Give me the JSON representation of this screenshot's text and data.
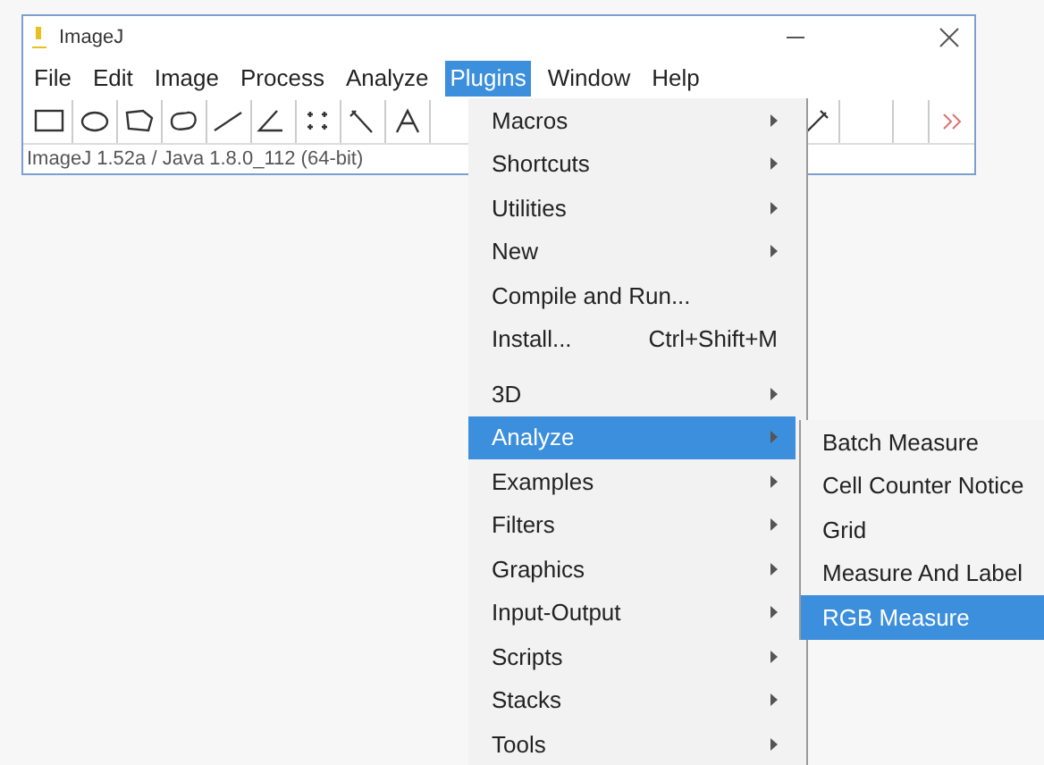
{
  "window": {
    "title": "ImageJ"
  },
  "menu_bar": [
    {
      "label": "File",
      "selected": false
    },
    {
      "label": "Edit",
      "selected": false
    },
    {
      "label": "Image",
      "selected": false
    },
    {
      "label": "Process",
      "selected": false
    },
    {
      "label": "Analyze",
      "selected": false
    },
    {
      "label": "Plugins",
      "selected": true
    },
    {
      "label": "Window",
      "selected": false
    },
    {
      "label": "Help",
      "selected": false
    }
  ],
  "status_bar": "ImageJ 1.52a / Java 1.8.0_112 (64-bit)",
  "plugins_menu": [
    {
      "label": "Macros",
      "submenu": true,
      "selected": false
    },
    {
      "label": "Shortcuts",
      "submenu": true,
      "selected": false
    },
    {
      "label": "Utilities",
      "submenu": true,
      "selected": false
    },
    {
      "label": "New",
      "submenu": true,
      "selected": false
    },
    {
      "label": "Compile and Run...",
      "submenu": false,
      "selected": false
    },
    {
      "label": "Install...",
      "shortcut": "Ctrl+Shift+M",
      "submenu": false,
      "selected": false
    },
    {
      "label": "3D",
      "submenu": true,
      "selected": false,
      "separator_before": true
    },
    {
      "label": "Analyze",
      "submenu": true,
      "selected": true
    },
    {
      "label": "Examples",
      "submenu": true,
      "selected": false
    },
    {
      "label": "Filters",
      "submenu": true,
      "selected": false
    },
    {
      "label": "Graphics",
      "submenu": true,
      "selected": false
    },
    {
      "label": "Input-Output",
      "submenu": true,
      "selected": false
    },
    {
      "label": "Scripts",
      "submenu": true,
      "selected": false
    },
    {
      "label": "Stacks",
      "submenu": true,
      "selected": false
    },
    {
      "label": "Tools",
      "submenu": true,
      "selected": false
    }
  ],
  "analyze_submenu": [
    {
      "label": "Batch Measure",
      "selected": false
    },
    {
      "label": "Cell Counter Notice",
      "selected": false
    },
    {
      "label": "Grid",
      "selected": false
    },
    {
      "label": "Measure And Label",
      "selected": false
    },
    {
      "label": "RGB Measure",
      "selected": true
    }
  ]
}
